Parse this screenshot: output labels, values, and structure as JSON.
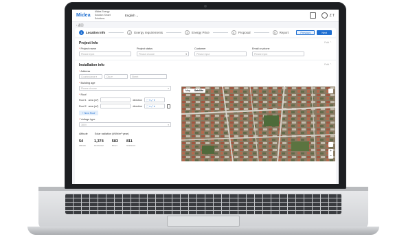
{
  "app": {
    "logo": "Midea",
    "subtitle": "Midea Energy Solution Smart Solutions",
    "language": "English ⌄",
    "user": "Z T"
  },
  "breadcrumb": "‹ 返回",
  "steps": [
    {
      "num": "1",
      "label": "Location Info",
      "active": true
    },
    {
      "num": "2",
      "label": "Energy requirements",
      "active": false
    },
    {
      "num": "3",
      "label": "Energy Price",
      "active": false
    },
    {
      "num": "4",
      "label": "Proposal",
      "active": false
    },
    {
      "num": "5",
      "label": "Report",
      "active": false
    }
  ],
  "buttons": {
    "previous": "Previous",
    "next": "Next"
  },
  "project": {
    "title": "Project Info",
    "fold": "Fold ⌃",
    "fields": [
      {
        "label": "Project name",
        "required": true,
        "placeholder": "Please input",
        "select": false
      },
      {
        "label": "Project status",
        "required": false,
        "placeholder": "Please choose",
        "select": true
      },
      {
        "label": "Customer",
        "required": false,
        "placeholder": "Please input",
        "select": false
      },
      {
        "label": "Email or phone",
        "required": false,
        "placeholder": "Please input",
        "select": false
      }
    ]
  },
  "installation": {
    "title": "Installation info",
    "fold": "Fold ⌃",
    "address_label": "Address",
    "address": {
      "country": "Country/area ▾",
      "city": "City ▾",
      "street": "Street"
    },
    "building_age_label": "Building age",
    "building_age_placeholder": "Please choose",
    "roof_label": "Roof",
    "roofs": [
      {
        "name": "Roof 1",
        "area_label": "area (m²)",
        "direction_label": "direction"
      },
      {
        "name": "Roof 2",
        "area_label": "area (m²)",
        "direction_label": "direction"
      }
    ],
    "new_roof": "+ New Roof",
    "voltage_label": "Voltage type",
    "voltage_value": "380V",
    "stats_header": {
      "altitude": "Altitude",
      "radiation": "Solar radiation  (kWh/m²·year)"
    },
    "stats": [
      {
        "value": "54",
        "unit": "Altitude"
      },
      {
        "value": "1,374",
        "unit": "Horizontal"
      },
      {
        "value": "583",
        "unit": "Direct"
      },
      {
        "value": "811",
        "unit": "Scattered"
      }
    ]
  },
  "map": {
    "tab_map": "Map",
    "tab_satellite": "Satellite",
    "zoom_in": "+",
    "zoom_out": "−"
  }
}
